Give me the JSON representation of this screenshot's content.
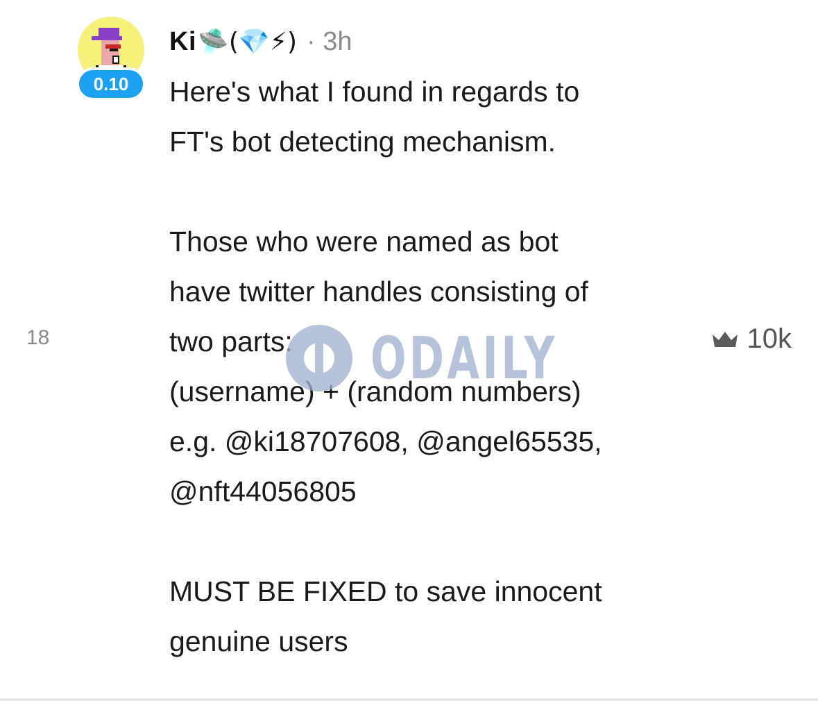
{
  "post": {
    "author": {
      "name": "Ki",
      "name_emoji": "🛸(💎⚡)",
      "badge": "0.10"
    },
    "time": "· 3h",
    "lines_block1": [
      "Here's what I found in regards to",
      "FT's bot detecting mechanism."
    ],
    "lines_block2": [
      "Those who were named as bot",
      "have twitter handles consisting of",
      "two parts:",
      "(username) + (random numbers)",
      "e.g. @ki18707608, @angel65535,",
      "@nft44056805"
    ],
    "lines_block3": [
      "MUST BE FIXED to save innocent",
      "genuine users"
    ],
    "reply_count": "18",
    "crown_count": "10k"
  },
  "watermark": {
    "text": "ODAILY"
  },
  "icons": {
    "crown": "crown-icon",
    "avatar": "pixel-avatar-icon",
    "watermark_logo": "odaily-logo-icon"
  },
  "colors": {
    "badge": "#1da1f2",
    "avatar_bg": "#f6f17a",
    "muted": "#8a8a8a",
    "watermark": "#9fb0cf"
  }
}
